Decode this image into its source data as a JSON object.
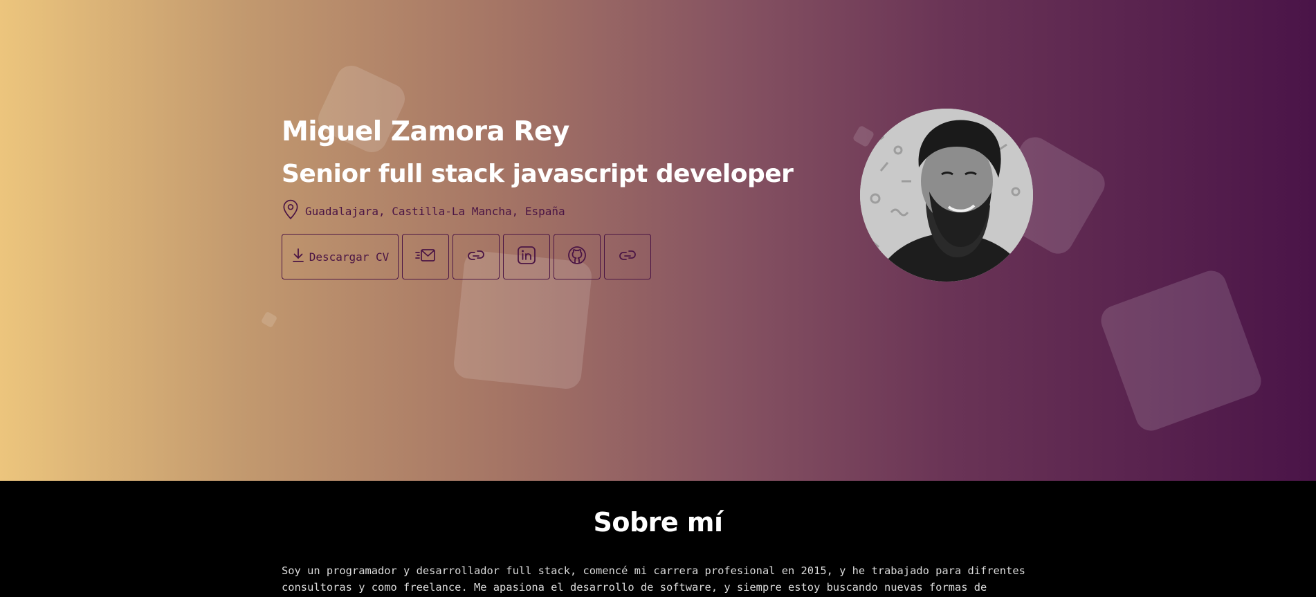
{
  "hero": {
    "name": "Miguel Zamora Rey",
    "role": "Senior full stack javascript developer",
    "location": "Guadalajara, Castilla-La Mancha, España",
    "download_cv_label": "Descargar CV",
    "actions": [
      {
        "icon": "mail-icon"
      },
      {
        "icon": "link-icon"
      },
      {
        "icon": "linkedin-icon"
      },
      {
        "icon": "github-icon"
      },
      {
        "icon": "link-icon"
      }
    ],
    "gradient": [
      "#ecc57d",
      "#4a1448"
    ],
    "accent": "#4a1444"
  },
  "about": {
    "title": "Sobre mí",
    "text": "Soy un programador y desarrollador full stack, comencé mi carrera profesional en 2015, y he trabajado para difrentes consultoras y como freelance. Me apasiona el desarrollo de software, y siempre estoy buscando nuevas formas de"
  }
}
